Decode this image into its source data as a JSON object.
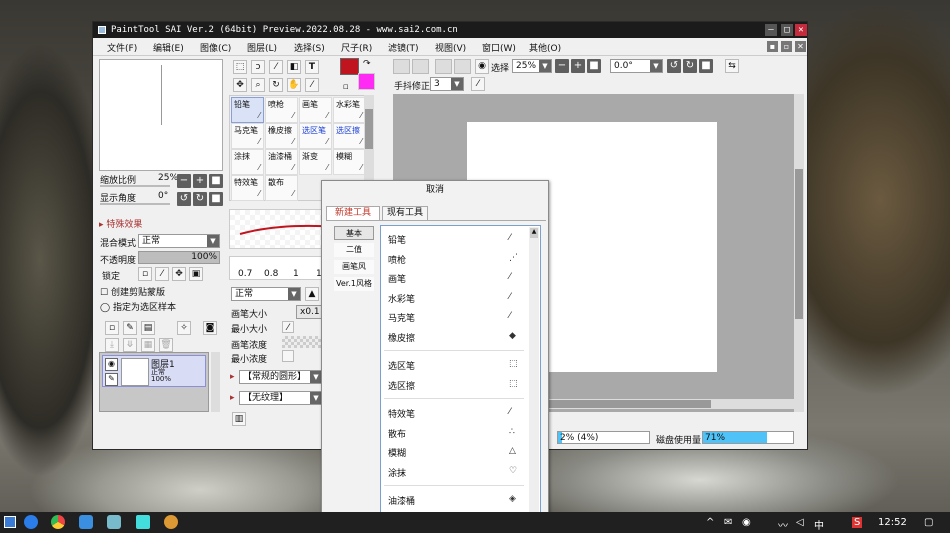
{
  "window": {
    "title": "PaintTool SAI Ver.2 (64bit) Preview.2022.08.28 - www.sai2.com.cn",
    "buttons": [
      "–",
      "□",
      "✕"
    ]
  },
  "menubar": {
    "items": [
      "文件(F)",
      "编辑(E)",
      "图像(C)",
      "图层(L)",
      "选择(S)",
      "尺子(R)",
      "滤镜(T)",
      "视图(V)",
      "窗口(W)",
      "其他(O)"
    ],
    "mdi_buttons": [
      "▪",
      "▫",
      "✕"
    ]
  },
  "navigator": {
    "zoom_label": "缩放比例",
    "zoom_value": "25%",
    "angle_label": "显示角度",
    "angle_value": "0°"
  },
  "effects": {
    "header": "特殊效果"
  },
  "layer_props": {
    "blend_label": "混合模式",
    "blend_value": "正常",
    "opacity_label": "不透明度",
    "opacity_value": "100%",
    "lock_label": "锁定",
    "clip_label": "创建剪贴蒙版",
    "select_source_label": "指定为选区样本"
  },
  "layers": [
    {
      "name": "图层1",
      "mode": "正常",
      "opacity": "100%"
    }
  ],
  "toolbar": {
    "stabilizer_label": "手抖修正",
    "stabilizer_value": "3",
    "select_label": "选择",
    "zoom_value": "25%",
    "angle_value": "0.0°"
  },
  "colors": {
    "primary": "#c0141e",
    "secondary": "#ff2bf5",
    "accent_blue": "#4fc3f7"
  },
  "tools": [
    {
      "name": "铅笔",
      "icon": "pencil-icon",
      "selected": true,
      "color": "#111"
    },
    {
      "name": "喷枪",
      "icon": "airbrush-icon",
      "selected": false,
      "color": "#111"
    },
    {
      "name": "画笔",
      "icon": "brush-icon",
      "selected": false,
      "color": "#111"
    },
    {
      "name": "水彩笔",
      "icon": "watercolor-icon",
      "selected": false,
      "color": "#111"
    },
    {
      "name": "马克笔",
      "icon": "marker-icon",
      "selected": false,
      "color": "#111"
    },
    {
      "name": "橡皮擦",
      "icon": "eraser-icon",
      "selected": false,
      "color": "#111"
    },
    {
      "name": "选区笔",
      "icon": "selpen-icon",
      "selected": false,
      "color": "#1a3fd6"
    },
    {
      "name": "选区擦",
      "icon": "selerase-icon",
      "selected": false,
      "color": "#1a3fd6"
    },
    {
      "name": "涂抹",
      "icon": "smudge-icon",
      "selected": false,
      "color": "#111"
    },
    {
      "name": "油漆桶",
      "icon": "bucket-icon",
      "selected": false,
      "color": "#111"
    },
    {
      "name": "渐变",
      "icon": "gradient-icon",
      "selected": false,
      "color": "#111"
    },
    {
      "name": "模糊",
      "icon": "blur-icon",
      "selected": false,
      "color": "#111"
    },
    {
      "name": "特效笔",
      "icon": "fxpen-icon",
      "selected": false,
      "color": "#111"
    },
    {
      "name": "散布",
      "icon": "scatter-icon",
      "selected": false,
      "color": "#111"
    }
  ],
  "brush_sizes": [
    "0.7",
    "0.8",
    "1",
    "1.5"
  ],
  "brush_props": {
    "mode_value": "正常",
    "size_label": "画笔大小",
    "size_multiplier": "x0.1",
    "min_size_label": "最小大小",
    "density_label": "画笔浓度",
    "min_density_label": "最小浓度",
    "shape_label": "【常规的圆形】",
    "texture_label": "【无纹理】"
  },
  "statusbar": {
    "memory_value": "2% (4%)",
    "memory_fill": 0.04,
    "disk_label": "磁盘使用量",
    "disk_value": "71%",
    "disk_fill": 0.71
  },
  "popup": {
    "title": "取消",
    "tab_new": "新建工具",
    "tab_existing": "现有工具",
    "categories": [
      "基本",
      "二值",
      "画笔风",
      "Ver.1风格"
    ],
    "group1": [
      {
        "label": "铅笔",
        "icon": "pencil-icon",
        "glyph": "⁄"
      },
      {
        "label": "喷枪",
        "icon": "airbrush-icon",
        "glyph": "⋰"
      },
      {
        "label": "画笔",
        "icon": "brush-icon",
        "glyph": "⁄"
      },
      {
        "label": "水彩笔",
        "icon": "watercolor-icon",
        "glyph": "⁄"
      },
      {
        "label": "马克笔",
        "icon": "marker-icon",
        "glyph": "⁄"
      },
      {
        "label": "橡皮擦",
        "icon": "eraser-icon",
        "glyph": "◆"
      }
    ],
    "group2": [
      {
        "label": "选区笔",
        "icon": "selpen-icon",
        "glyph": "⬚"
      },
      {
        "label": "选区擦",
        "icon": "selerase-icon",
        "glyph": "⬚"
      }
    ],
    "group3": [
      {
        "label": "特效笔",
        "icon": "fxpen-icon",
        "glyph": "⁄"
      },
      {
        "label": "散布",
        "icon": "scatter-icon",
        "glyph": "∴"
      },
      {
        "label": "模糊",
        "icon": "blur-icon",
        "glyph": "△"
      },
      {
        "label": "涂抹",
        "icon": "smudge-icon",
        "glyph": "♡"
      }
    ],
    "group4": [
      {
        "label": "油漆桶",
        "icon": "bucket-icon",
        "glyph": "◈"
      },
      {
        "label": "渐变",
        "icon": "gradient-icon",
        "glyph": "▬"
      }
    ]
  },
  "taskbar": {
    "time": "12:52",
    "ime": "中",
    "tray_icons": [
      "^",
      "✉",
      "◉",
      "〰",
      "◁",
      "中",
      "S"
    ]
  }
}
